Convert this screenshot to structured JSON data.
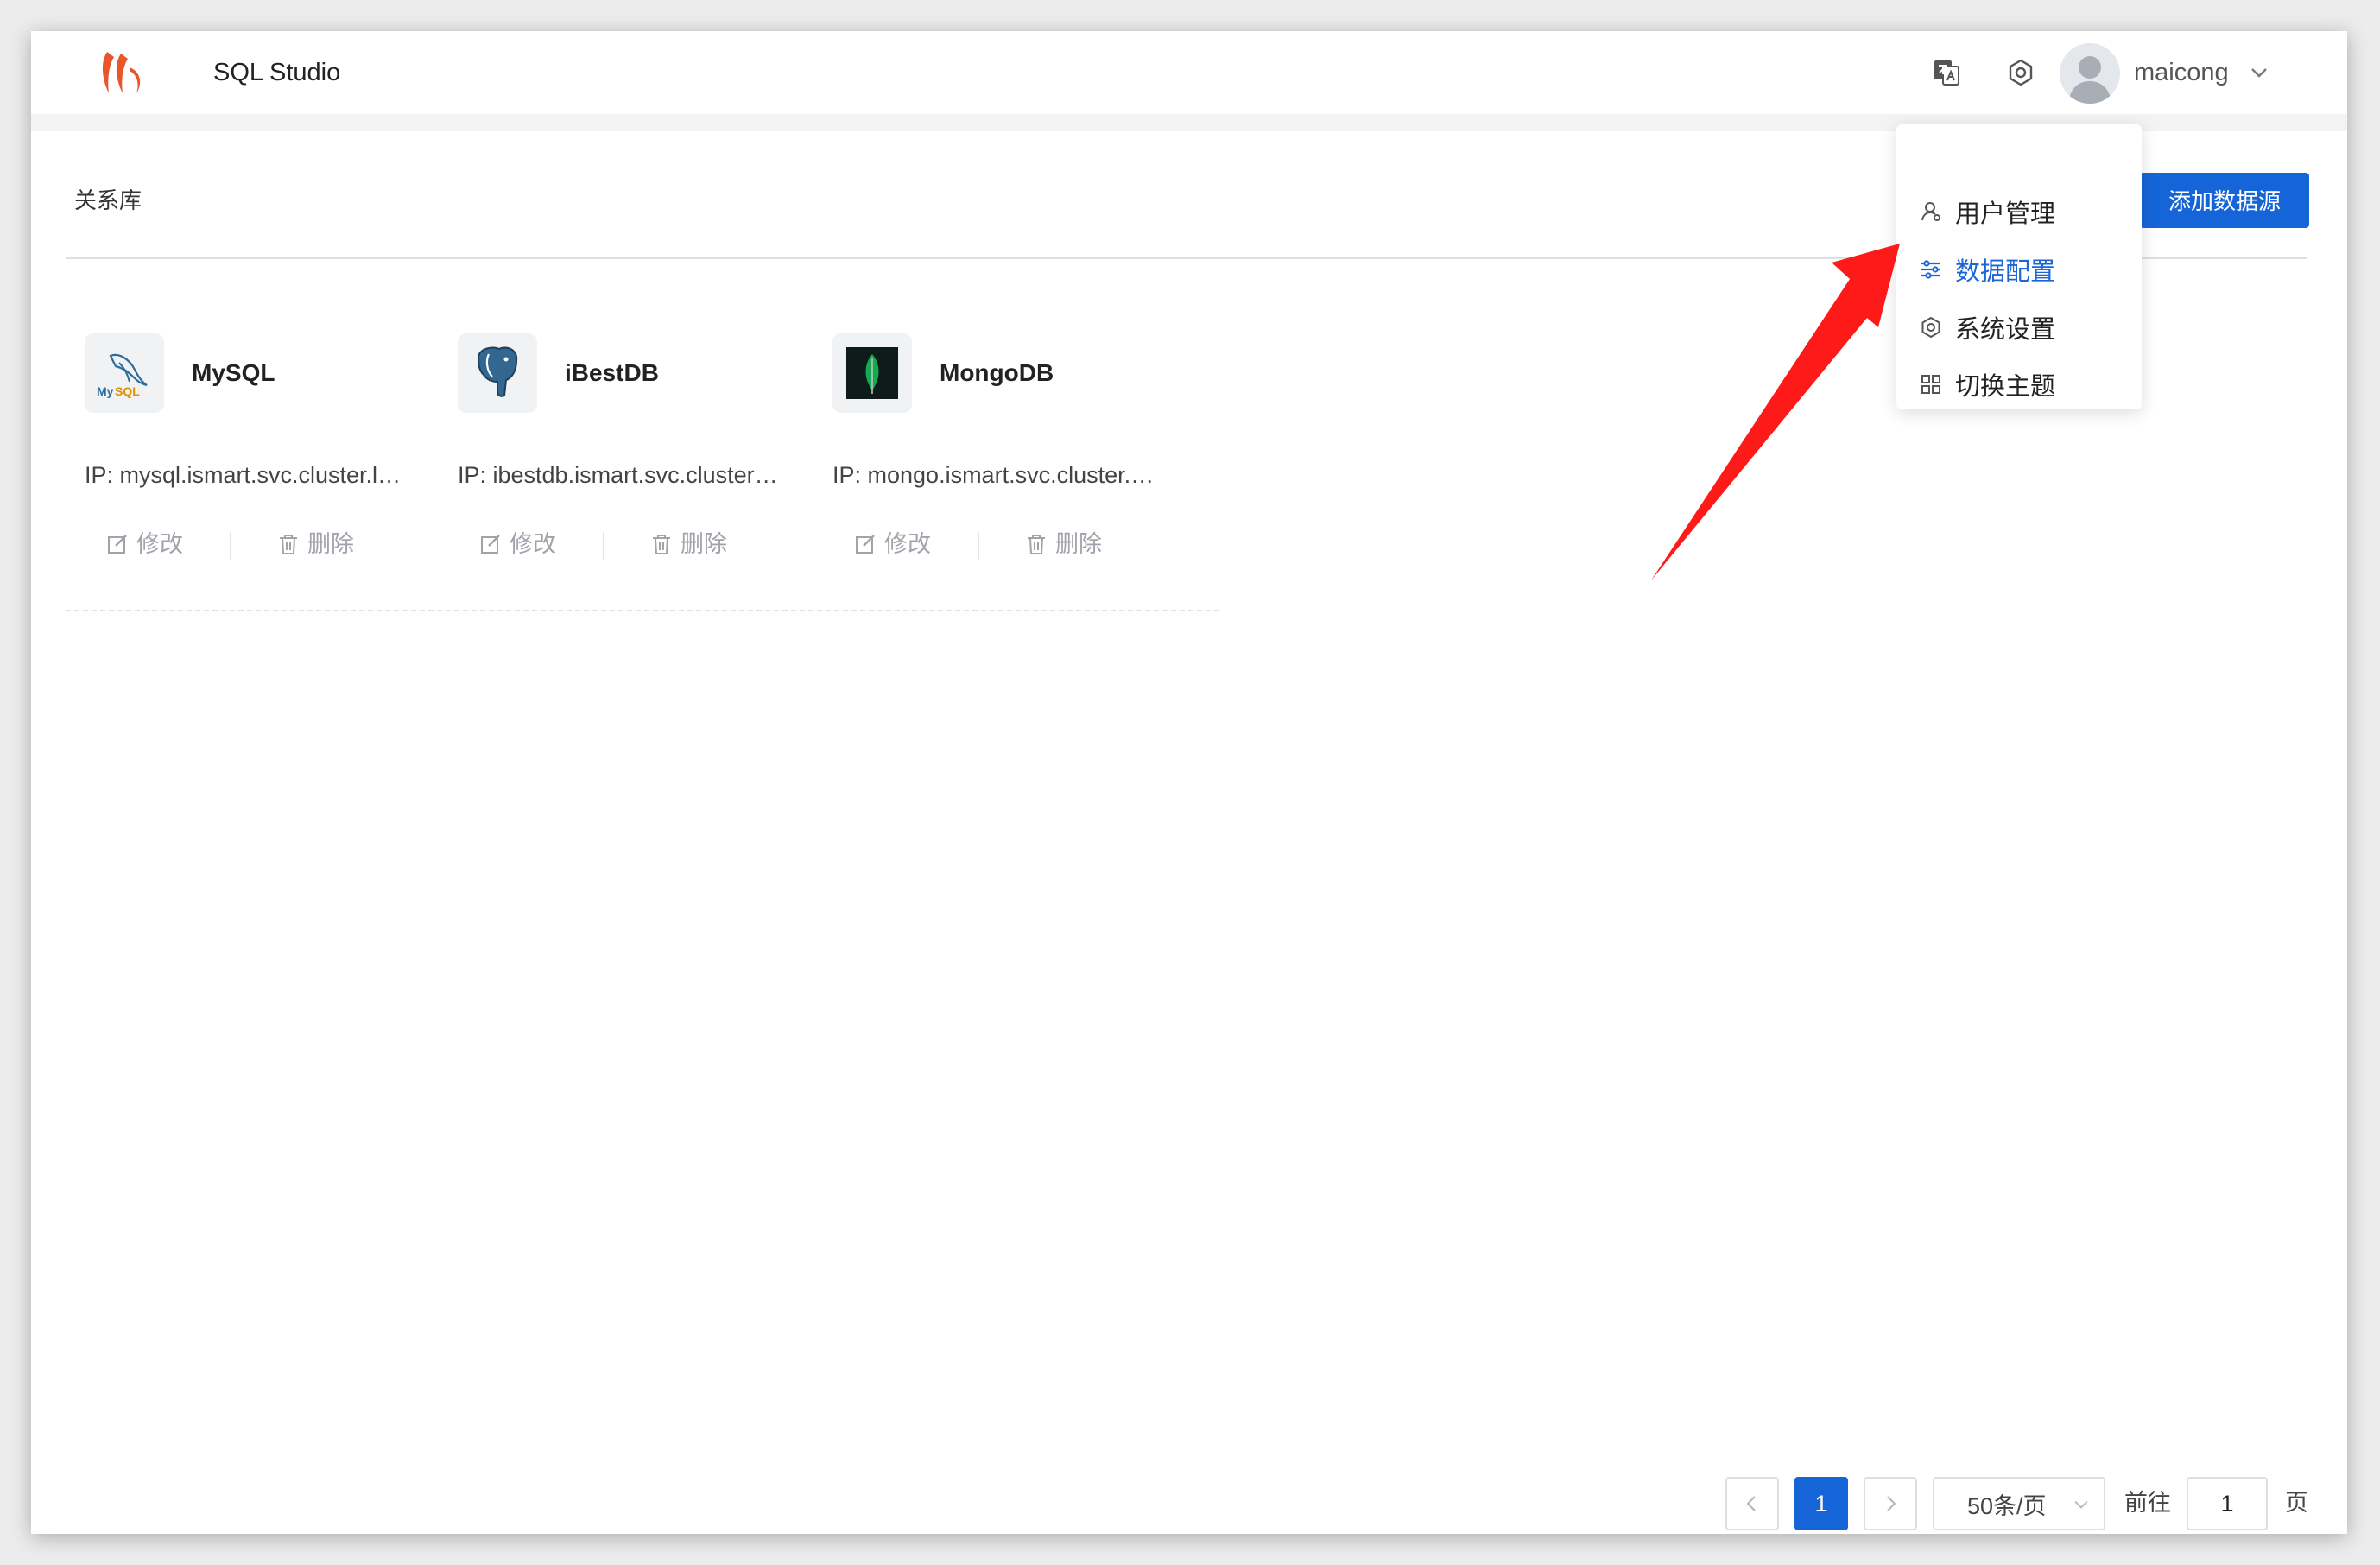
{
  "header": {
    "app_title": "SQL Studio",
    "user_name": "maicong",
    "icons": [
      "translate-icon",
      "settings-icon",
      "avatar",
      "chevron-down-icon"
    ]
  },
  "section": {
    "title": "关系库",
    "add_button": "添加数据源"
  },
  "datasources": [
    {
      "name": "MySQL",
      "ip": "IP: mysql.ismart.svc.cluster.l…",
      "edit": "修改",
      "delete": "删除",
      "icon": "mysql-logo"
    },
    {
      "name": "iBestDB",
      "ip": "IP: ibestdb.ismart.svc.cluster…",
      "edit": "修改",
      "delete": "删除",
      "icon": "elephant-logo"
    },
    {
      "name": "MongoDB",
      "ip": "IP: mongo.ismart.svc.cluster.…",
      "edit": "修改",
      "delete": "删除",
      "icon": "mongodb-leaf-logo"
    }
  ],
  "user_menu": {
    "items": [
      {
        "label": "用户管理",
        "icon": "user-icon",
        "active": false
      },
      {
        "label": "数据配置",
        "icon": "sliders-icon",
        "active": true
      },
      {
        "label": "系统设置",
        "icon": "settings-icon",
        "active": false
      },
      {
        "label": "切换主题",
        "icon": "grid-icon",
        "active": false
      }
    ]
  },
  "annotation": {
    "color": "#ff1a1a"
  },
  "pagination": {
    "current_page": "1",
    "page_size": "50条/页",
    "goto_label": "前往",
    "goto_value": "1",
    "page_suffix": "页"
  },
  "colors": {
    "primary": "#1665d8",
    "logo": "#e8562b"
  }
}
